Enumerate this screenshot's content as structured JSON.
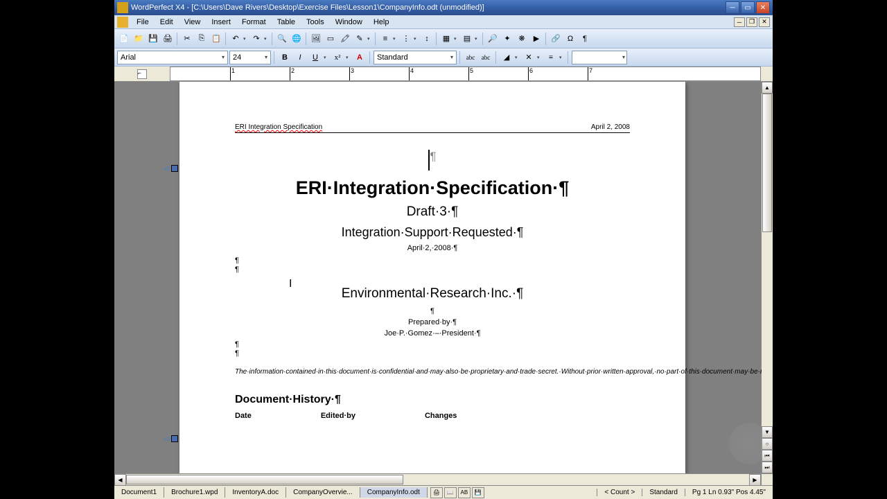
{
  "title": "WordPerfect X4 - [C:\\Users\\Dave Rivers\\Desktop\\Exercise Files\\Lesson1\\CompanyInfo.odt (unmodified)]",
  "menu": [
    "File",
    "Edit",
    "View",
    "Insert",
    "Format",
    "Table",
    "Tools",
    "Window",
    "Help"
  ],
  "font": {
    "name": "Arial",
    "size": "24",
    "style": "Standard"
  },
  "ruler_marks": [
    "1",
    "2",
    "3",
    "4",
    "5",
    "6",
    "7"
  ],
  "page": {
    "header_left": "ERI Integration Specification",
    "header_right": "April 2, 2008",
    "title": "ERI·Integration·Specification·¶",
    "draft": "Draft·3·¶",
    "subtitle": "Integration·Support·Requested·¶",
    "date": "April·2,·2008·¶",
    "company": "Environmental·Research·Inc.·¶",
    "pilcrow": "¶",
    "prepared": "Prepared·by·¶",
    "author": "Joe·P.·Gomez·–·President·¶",
    "legal": "The·information·contained·in·this·document·is·confidential·and·may·also·be·proprietary·and·trade·secret.·Without·prior·written·approval,·no·part·of·this·document·may·be·reproduced·or·transmitted·in·any·form·or·by·any·means,·including·but·not·limited·to·electronic,·mechanical,·photocopying·or·recording·or·stored·in·any·retrieval·system·of·whatever·nature.·Use·of·any·copyright·notice·does·not·imply·unrestricted·public·access·to·any·part·of·this·document.·Trademarks·are·acknowledged·as·the·property·of·their·rightful·owners.·¶",
    "history": "Document·History·¶",
    "th1": "Date",
    "th2": "Edited·by",
    "th3": "Changes"
  },
  "tabs": [
    "Document1",
    "Brochure1.wpd",
    "InventoryA.doc",
    "CompanyOvervie...",
    "CompanyInfo.odt"
  ],
  "status": {
    "count": "< Count >",
    "mode": "Standard",
    "pos": "Pg 1 Ln 0.93\" Pos 4.45\""
  }
}
